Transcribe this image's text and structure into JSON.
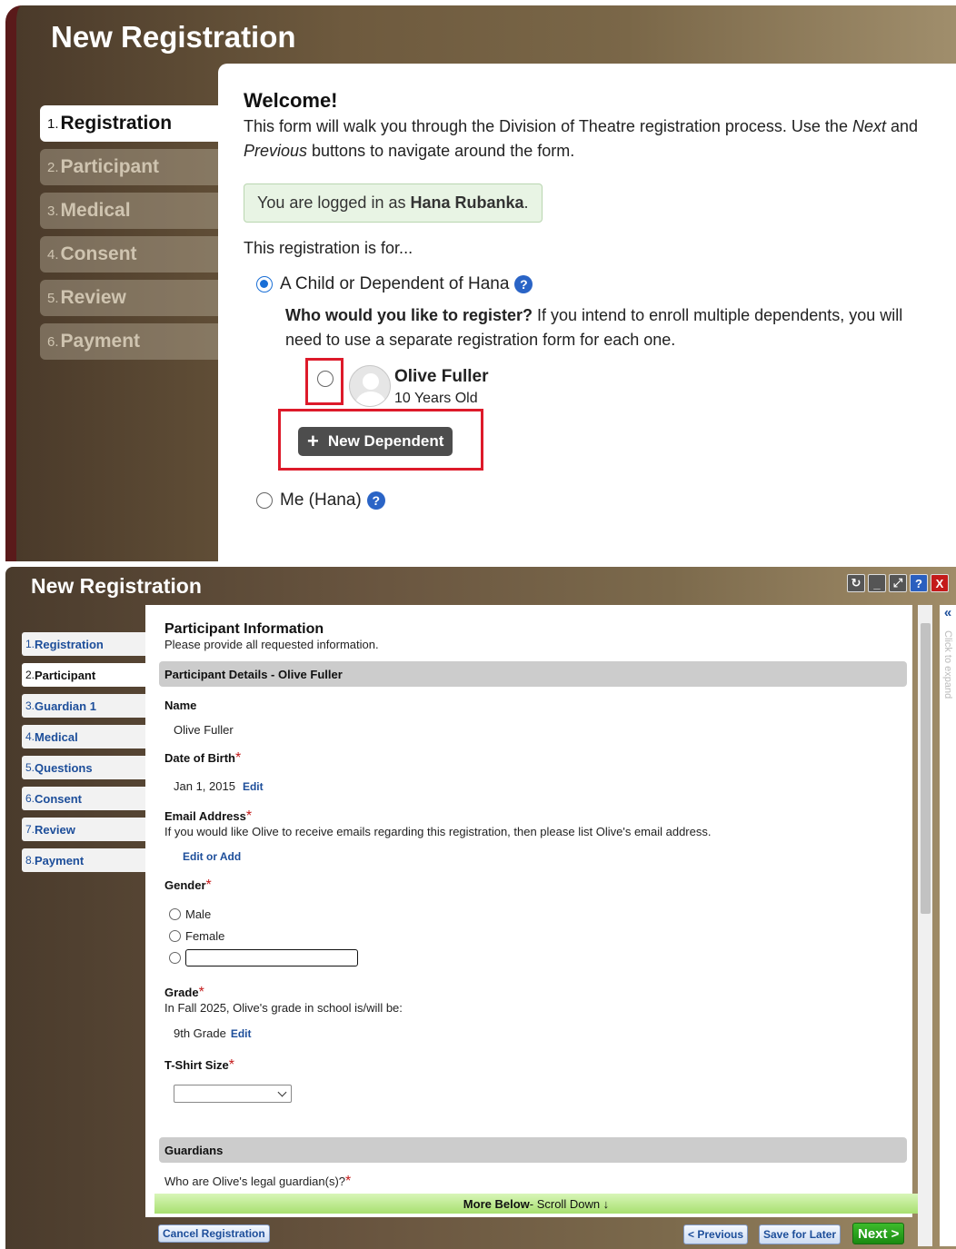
{
  "panel1": {
    "title": "New Registration",
    "steps": [
      {
        "num": "1.",
        "label": "Registration"
      },
      {
        "num": "2.",
        "label": "Participant"
      },
      {
        "num": "3.",
        "label": "Medical"
      },
      {
        "num": "4.",
        "label": "Consent"
      },
      {
        "num": "5.",
        "label": "Review"
      },
      {
        "num": "6.",
        "label": "Payment"
      }
    ],
    "welcome": "Welcome!",
    "intro_1": "This form will walk you through the Division of Theatre registration process. Use the ",
    "intro_next": "Next",
    "intro_2": " and ",
    "intro_prev": "Previous",
    "intro_3": " buttons to navigate around the form.",
    "logged_prefix": "You are logged in as ",
    "logged_user": "Hana Rubanka",
    "logged_suffix": ".",
    "registration_for": "This registration is for...",
    "option_child": "A Child or Dependent of Hana",
    "who_bold": "Who would you like to register?",
    "who_rest": " If you intend to enroll multiple dependents, you will need to use a separate registration form for each one.",
    "dependent_name": "Olive Fuller",
    "dependent_age": "10 Years Old",
    "new_dependent": "New Dependent",
    "option_me": "Me (Hana)"
  },
  "panel2": {
    "title": "New Registration",
    "steps": [
      {
        "num": "1.",
        "label": "Registration"
      },
      {
        "num": "2.",
        "label": "Participant"
      },
      {
        "num": "3.",
        "label": "Guardian 1"
      },
      {
        "num": "4.",
        "label": "Medical"
      },
      {
        "num": "5.",
        "label": "Questions"
      },
      {
        "num": "6.",
        "label": "Consent"
      },
      {
        "num": "7.",
        "label": "Review"
      },
      {
        "num": "8.",
        "label": "Payment"
      }
    ],
    "heading": "Participant Information",
    "subheading": "Please provide all requested information.",
    "section_details": "Participant Details - Olive Fuller",
    "name_label": "Name",
    "name_value": "Olive Fuller",
    "dob_label": "Date of Birth",
    "dob_value": "Jan 1, 2015",
    "edit": "Edit",
    "email_label": "Email Address",
    "email_desc": "If you would like Olive to receive emails regarding this registration, then please list Olive's email address.",
    "email_link": "Edit or Add",
    "gender_label": "Gender",
    "gender_male": "Male",
    "gender_female": "Female",
    "grade_label": "Grade",
    "grade_desc": "In Fall 2025, Olive's grade in school is/will be:",
    "grade_value": "9th Grade",
    "tshirt_label": "T-Shirt Size",
    "section_guardians": "Guardians",
    "guardians_question": "Who are Olive's legal guardian(s)?",
    "more_bold": "More Below",
    "more_rest": " - Scroll Down ↓",
    "expand_text": "Click to expand",
    "cancel": "Cancel Registration",
    "previous": "< Previous",
    "save_later": "Save for Later",
    "next": "Next >",
    "req_star": "*"
  }
}
